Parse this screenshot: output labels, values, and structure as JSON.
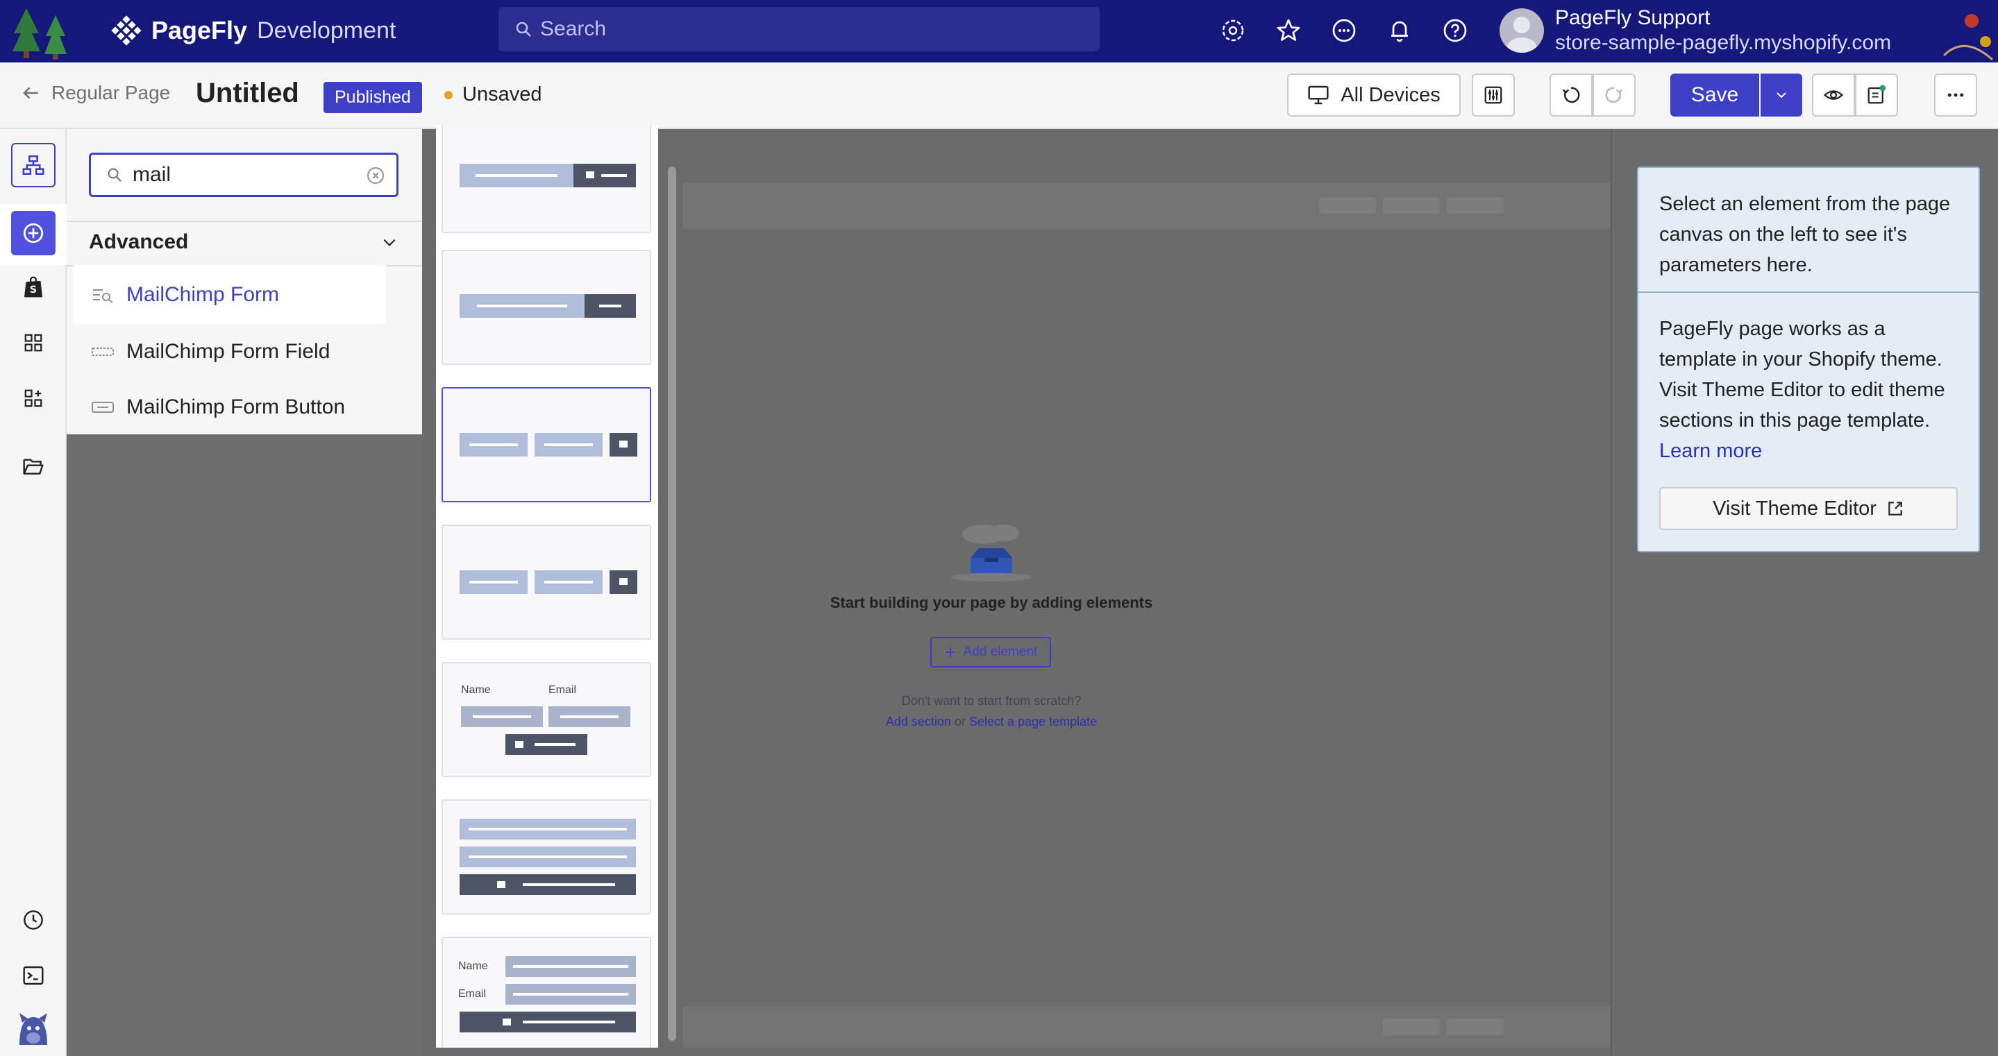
{
  "topbar": {
    "brand_name": "PageFly",
    "brand_env": "Development",
    "search_placeholder": "Search",
    "user_name": "PageFly Support",
    "user_store": "store-sample-pagefly.myshopify.com"
  },
  "header": {
    "back_label": "Regular Page",
    "page_title": "Untitled",
    "status_badge": "Published",
    "save_state": "Unsaved",
    "devices_label": "All Devices",
    "save_label": "Save"
  },
  "panel": {
    "search_value": "mail",
    "section_title": "Advanced",
    "items": [
      {
        "label": "MailChimp Form"
      },
      {
        "label": "MailChimp Form Field"
      },
      {
        "label": "MailChimp Form Button"
      }
    ]
  },
  "templates": {
    "name_label": "Name",
    "email_label": "Email"
  },
  "canvas": {
    "empty_title": "Start building your page by adding elements",
    "add_element_label": "Add element",
    "scratch_text": "Don't want to start from scratch?",
    "add_section_link": "Add section",
    "or_text": "or",
    "select_template_link": "Select a page template"
  },
  "right_panel": {
    "select_hint": "Select an element from the page canvas on the left to see it's parameters here.",
    "template_info": "PageFly page works as a template in your Shopify theme. Visit Theme Editor to edit theme sections in this page template.",
    "learn_more": "Learn more",
    "visit_editor_label": "Visit Theme Editor"
  },
  "colors": {
    "topbar_bg": "#15177a",
    "accent": "#3d3fc6",
    "unsaved_dot": "#e0a526"
  }
}
